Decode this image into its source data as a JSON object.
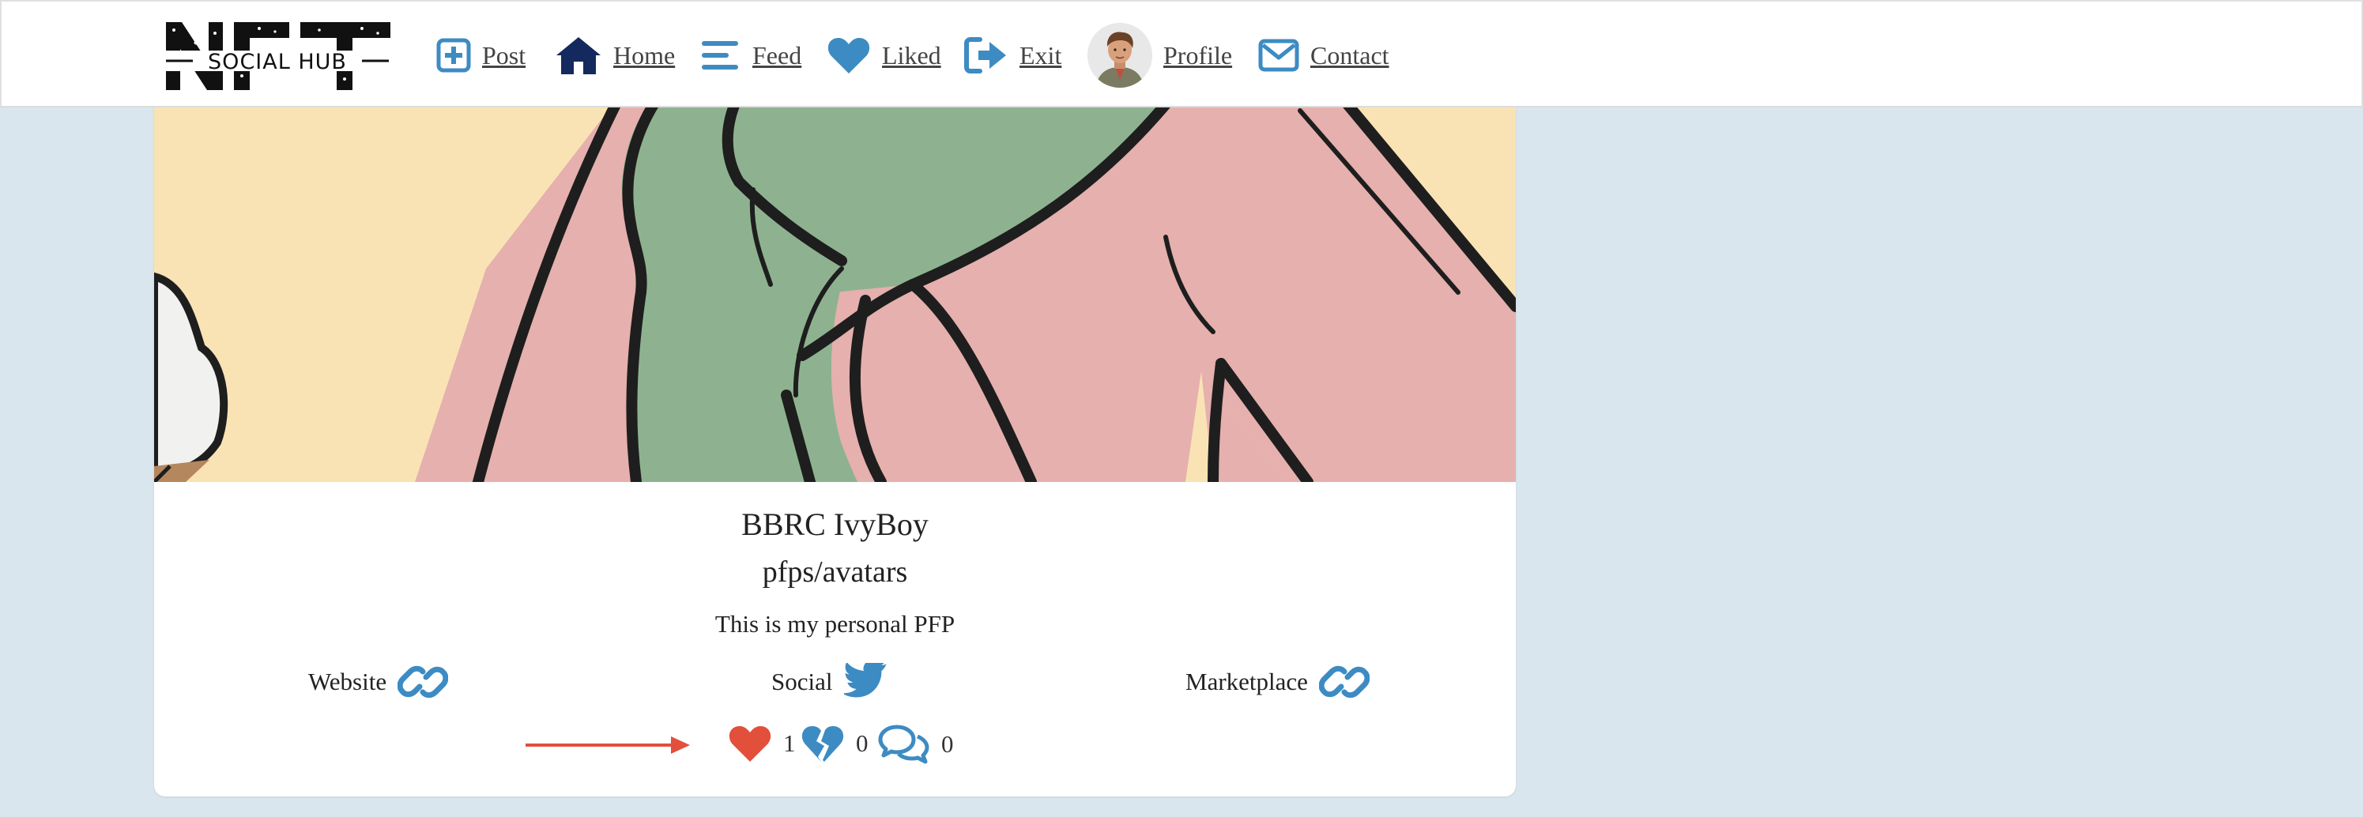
{
  "logo": {
    "text_big": "NFT",
    "text_small": "SOCIAL HUB"
  },
  "nav": {
    "post": "Post",
    "home": "Home",
    "feed": "Feed",
    "liked": "Liked",
    "exit": "Exit",
    "profile": "Profile",
    "contact": "Contact"
  },
  "card": {
    "title": "BBRC IvyBoy",
    "category": "pfps/avatars",
    "description": "This is my personal PFP",
    "links": {
      "website": "Website",
      "social": "Social",
      "marketplace": "Marketplace"
    },
    "stats": {
      "likes": "1",
      "dislikes": "0",
      "comments": "0"
    }
  },
  "colors": {
    "accent_blue": "#3d8bc3",
    "home_navy": "#14295e",
    "like_red": "#e24f3b",
    "page_bg": "#dae6ed"
  },
  "icons": [
    "plus-square-icon",
    "home-icon",
    "bars-icon",
    "heart-icon",
    "sign-out-icon",
    "envelope-icon",
    "link-icon",
    "twitter-icon",
    "heart-broken-icon",
    "comments-icon",
    "arrow-right-icon"
  ]
}
